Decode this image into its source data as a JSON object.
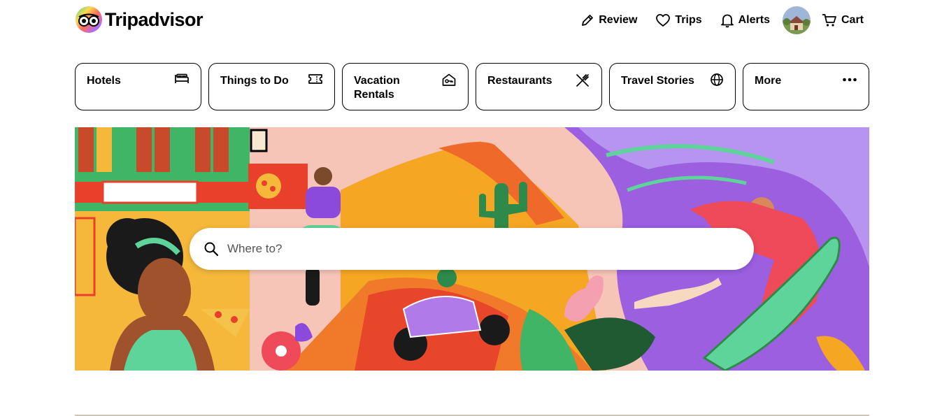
{
  "brand": {
    "name": "Tripadvisor",
    "icon": "owl-logo-icon"
  },
  "nav": {
    "review": {
      "label": "Review",
      "icon": "pencil-icon"
    },
    "trips": {
      "label": "Trips",
      "icon": "heart-icon"
    },
    "alerts": {
      "label": "Alerts",
      "icon": "bell-icon"
    },
    "cart": {
      "label": "Cart",
      "icon": "cart-icon"
    }
  },
  "tabs": [
    {
      "label": "Hotels",
      "icon": "bed-icon"
    },
    {
      "label": "Things to Do",
      "icon": "ticket-icon"
    },
    {
      "label": "Vacation Rentals",
      "icon": "house-key-icon"
    },
    {
      "label": "Restaurants",
      "icon": "fork-knife-icon"
    },
    {
      "label": "Travel Stories",
      "icon": "globe-icon"
    },
    {
      "label": "More",
      "icon": "more-dots-icon"
    }
  ],
  "search": {
    "placeholder": "Where to?"
  },
  "colors": {
    "accent": "#34e0a1",
    "text": "#000000",
    "border": "#000000"
  }
}
